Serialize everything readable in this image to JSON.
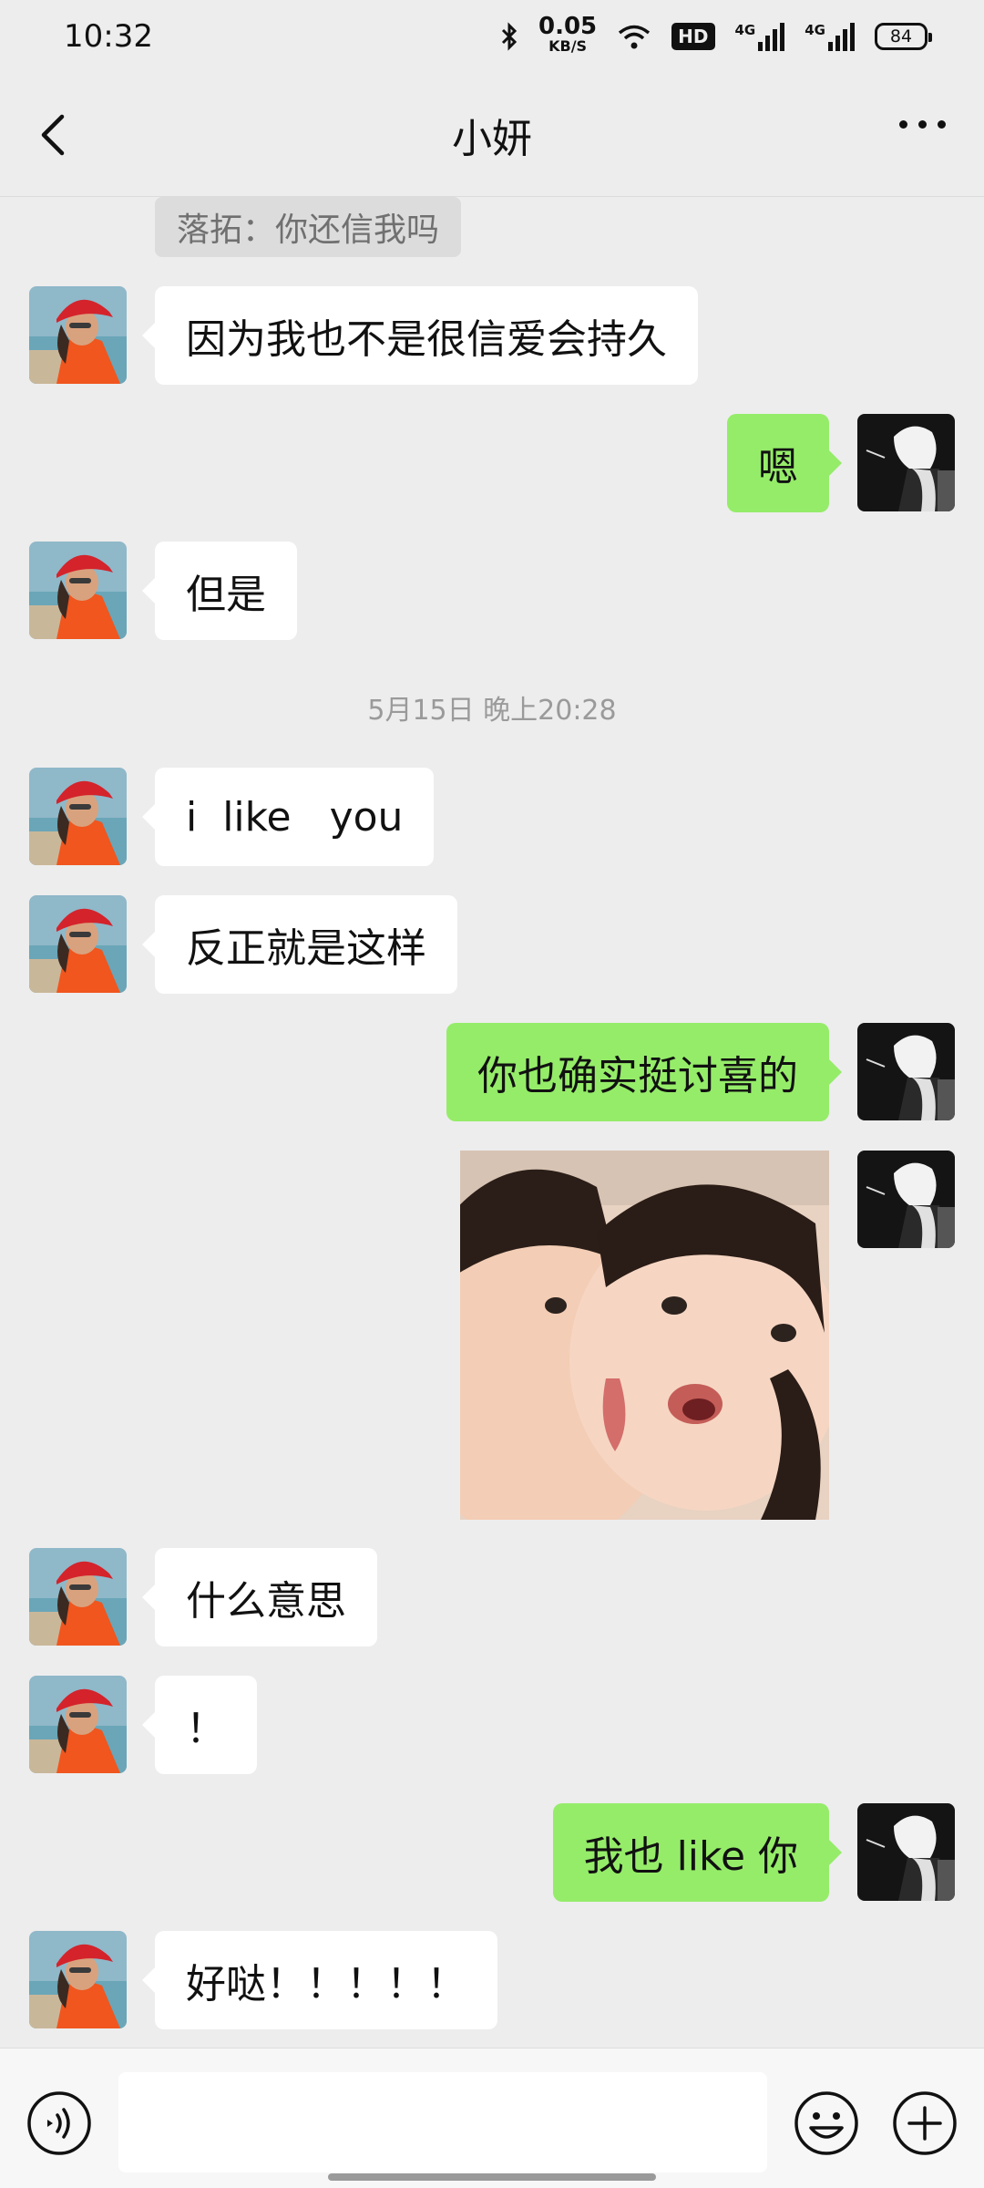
{
  "status_bar": {
    "time": "10:32",
    "net_speed": "0.05",
    "net_unit": "KB/S",
    "hd_label": "HD",
    "sim1_label": "4G",
    "sim2_label": "4G",
    "battery": "84",
    "icons": [
      "bluetooth-icon",
      "wifi-icon",
      "hd-icon",
      "signal-icon",
      "signal-icon",
      "battery-icon"
    ]
  },
  "nav": {
    "title": "小妍",
    "back_icon": "chevron-left-icon",
    "more_icon": "more-dots-icon"
  },
  "chat": {
    "quoted_reply": "落拓：你还信我吗",
    "timestamp": "5月15日 晚上20:28",
    "messages": [
      {
        "from": "contact",
        "text": "因为我也不是很信爱会持久"
      },
      {
        "from": "me",
        "text": "嗯"
      },
      {
        "from": "contact",
        "text": "但是"
      },
      {
        "from": "contact",
        "text": "i  like   you"
      },
      {
        "from": "contact",
        "text": "反正就是这样"
      },
      {
        "from": "me",
        "text": "你也确实挺讨喜的"
      },
      {
        "from": "me",
        "sticker": "two-babies-sticker"
      },
      {
        "from": "contact",
        "text": "什么意思"
      },
      {
        "from": "contact",
        "text": "！"
      },
      {
        "from": "me",
        "text": "我也 like 你"
      },
      {
        "from": "contact",
        "text": "好哒！！！！！"
      }
    ]
  },
  "input_bar": {
    "placeholder": "",
    "voice_icon": "voice-icon",
    "emoji_icon": "emoji-icon",
    "plus_icon": "plus-icon"
  },
  "colors": {
    "background": "#ededed",
    "outgoing_bubble": "#95ec69",
    "incoming_bubble": "#ffffff"
  }
}
